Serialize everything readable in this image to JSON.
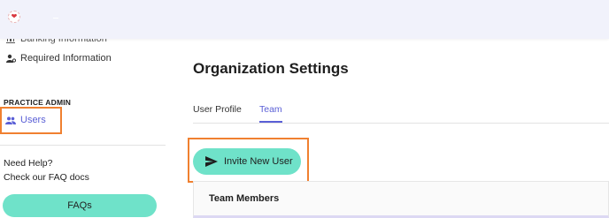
{
  "app": {
    "logo_icon": "heart-logo-icon"
  },
  "sidebar": {
    "items": [
      {
        "label": "Banking Information",
        "icon": "bank-icon"
      },
      {
        "label": "Required Information",
        "icon": "person-gear-icon"
      }
    ],
    "section_title": "PRACTICE ADMIN",
    "users": {
      "label": "Users",
      "icon": "users-icon"
    },
    "help_title": "Need Help?",
    "help_subtitle": "Check our FAQ docs",
    "faq_button": "FAQs"
  },
  "main": {
    "page_title": "Organization Settings",
    "tabs": [
      {
        "label": "User Profile",
        "active": false
      },
      {
        "label": "Team",
        "active": true
      }
    ],
    "invite_button": "Invite New User",
    "team_card_title": "Team Members"
  },
  "colors": {
    "accent": "#5a5fd6",
    "button_green": "#6fe2c9",
    "highlight_orange": "#f08030",
    "topbar": "#f1f2fb"
  }
}
